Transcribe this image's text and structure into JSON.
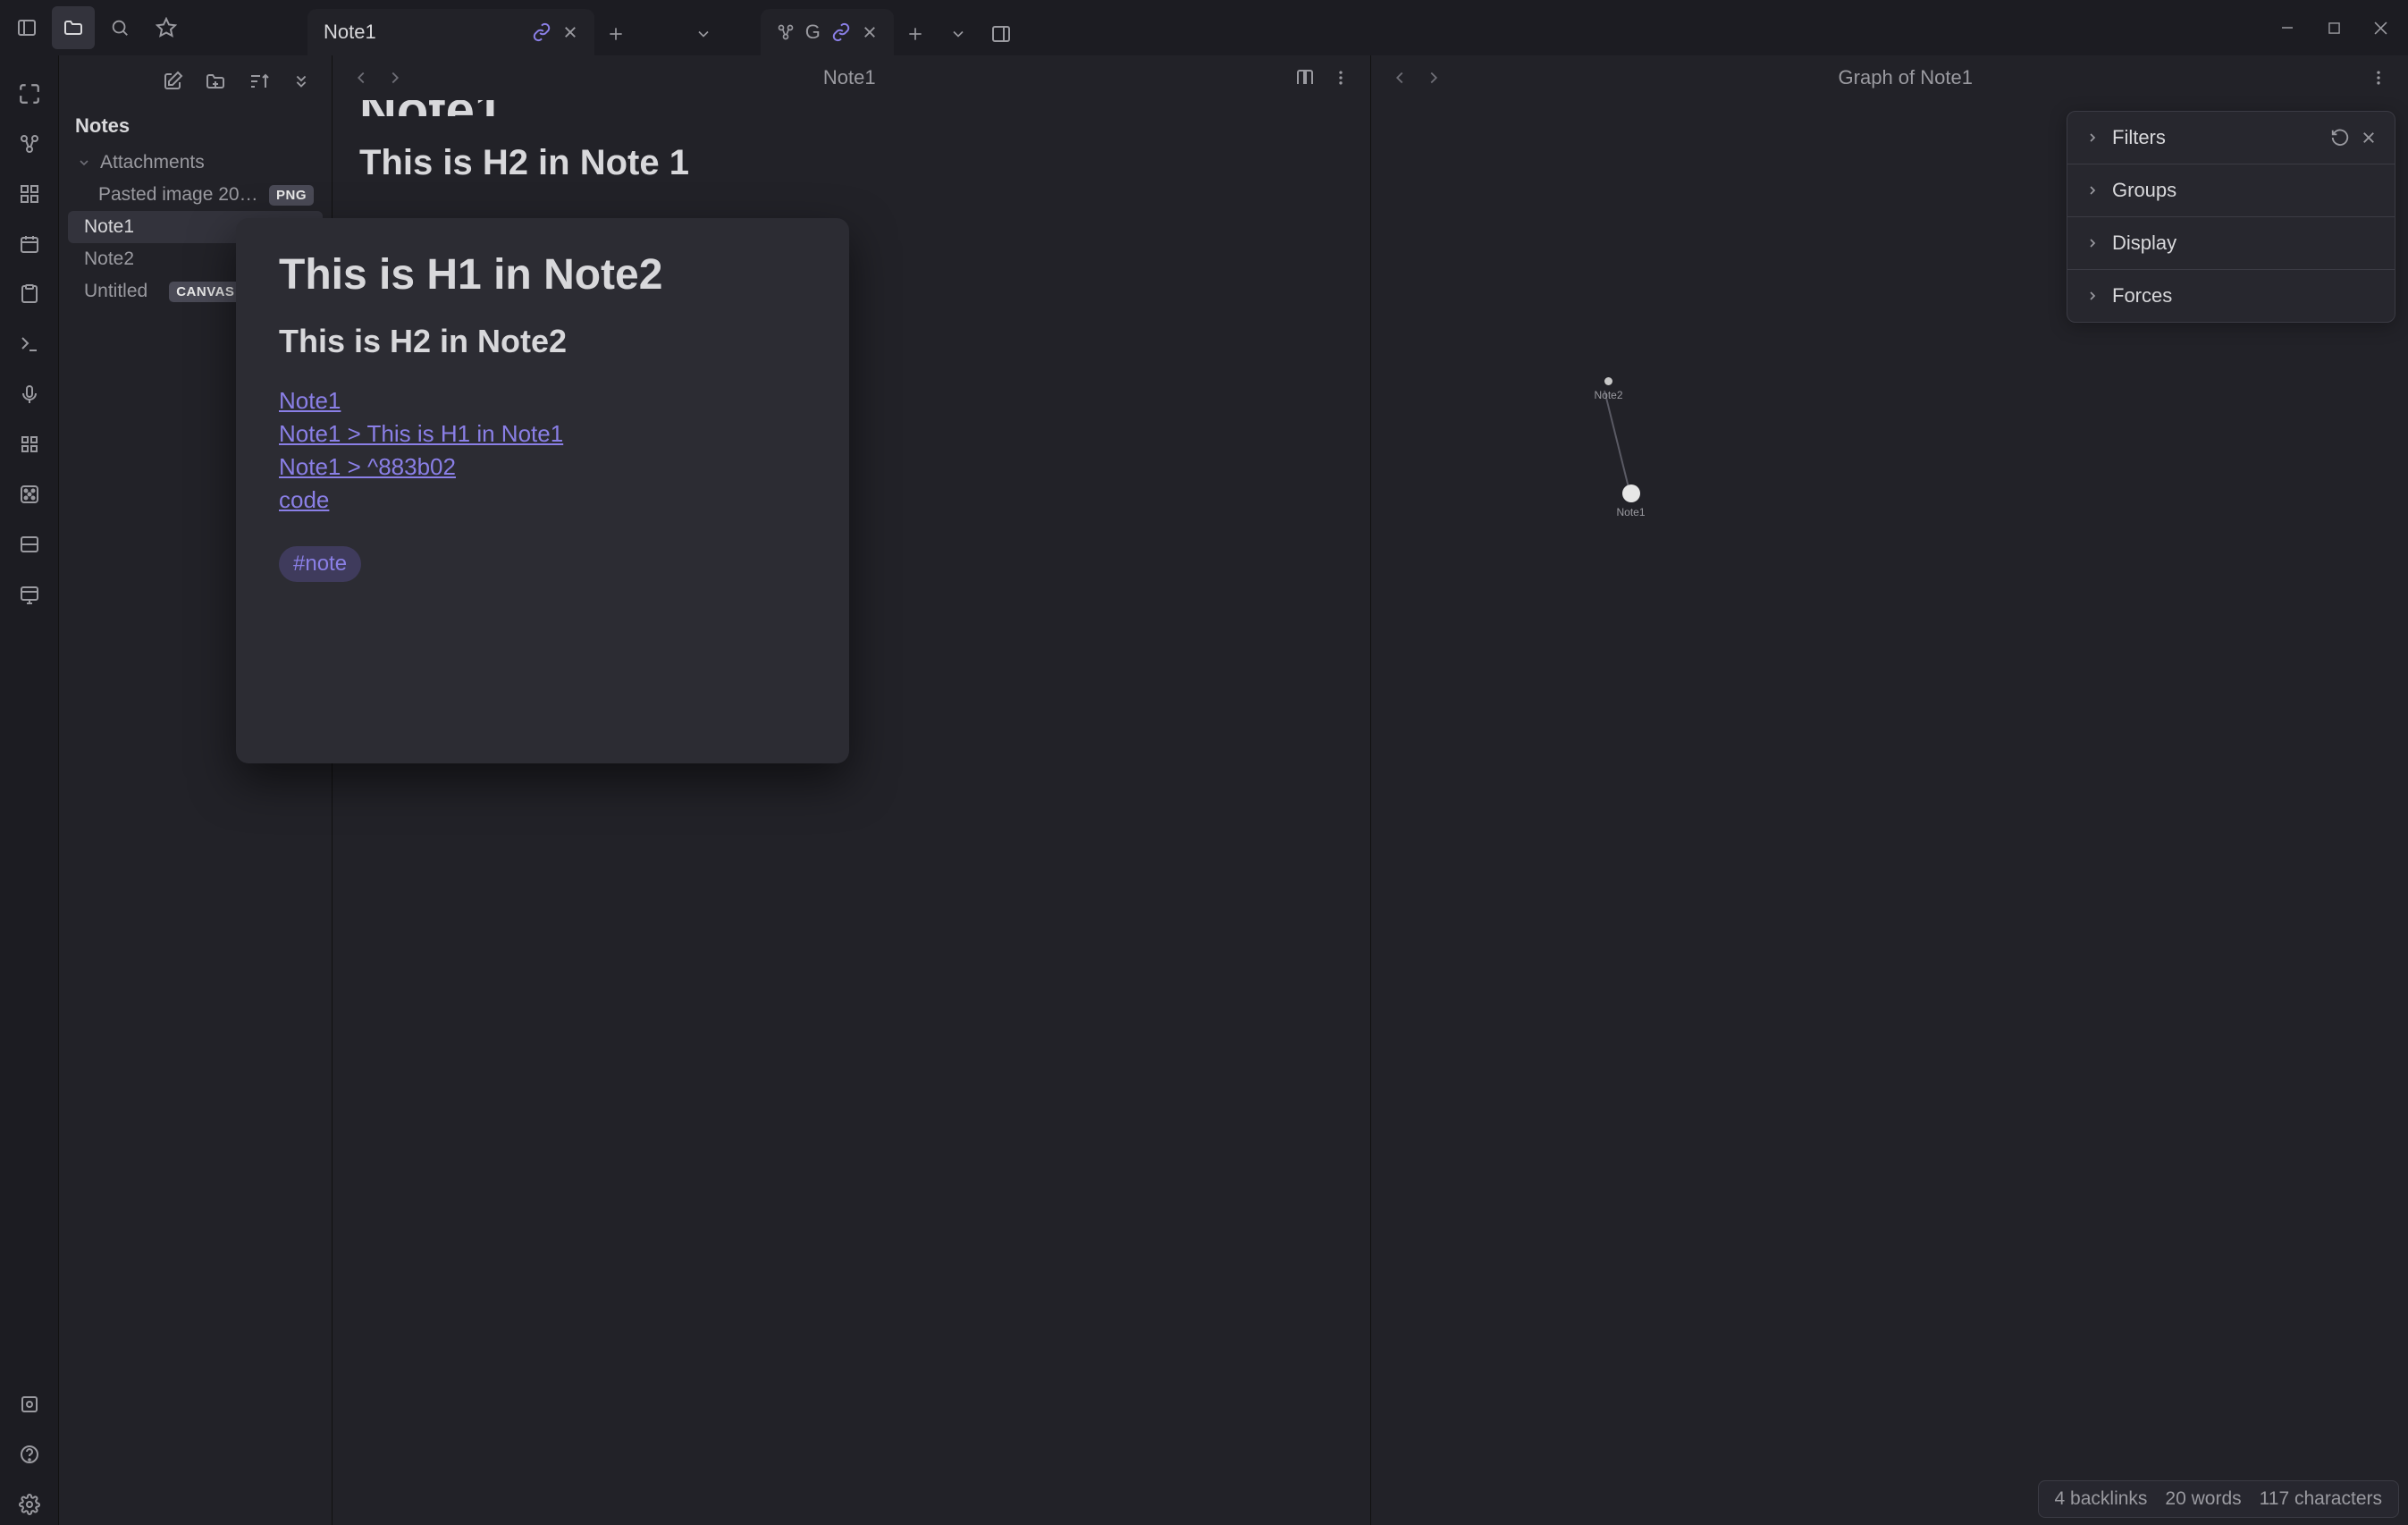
{
  "titlebar": {
    "tabs": [
      {
        "label": "Note1",
        "linked": true
      },
      {
        "label": "G",
        "linked": true,
        "icon": "graph"
      }
    ]
  },
  "sidebar": {
    "title": "Notes",
    "folder": {
      "name": "Attachments"
    },
    "attachment": {
      "name": "Pasted image 20…",
      "badge": "PNG"
    },
    "files": [
      {
        "name": "Note1",
        "active": true
      },
      {
        "name": "Note2"
      },
      {
        "name": "Untitled",
        "badge": "CANVAS"
      }
    ]
  },
  "pane_left": {
    "title": "Note1",
    "h1_cut": "Note1",
    "h2": "This is H2 in Note 1"
  },
  "popover": {
    "h1": "This is H1 in Note2",
    "h2": "This is H2 in Note2",
    "links": [
      "Note1",
      "Note1 > This is H1 in Note1",
      "Note1 > ^883b02",
      "code"
    ],
    "tag": "#note"
  },
  "pane_right": {
    "title": "Graph of Note1",
    "options": [
      "Filters",
      "Groups",
      "Display",
      "Forces"
    ],
    "nodes": {
      "a": "Note2",
      "b": "Note1"
    }
  },
  "status": {
    "backlinks": "4 backlinks",
    "words": "20 words",
    "chars": "117 characters"
  }
}
